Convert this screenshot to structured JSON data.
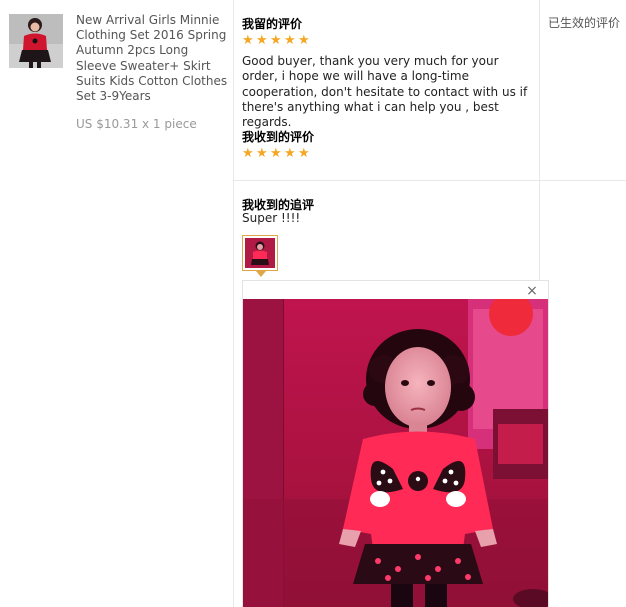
{
  "product": {
    "title": "New Arrival Girls Minnie Clothing Set 2016 Spring Autumn 2pcs Long Sleeve Sweater+ Skirt Suits Kids Cotton Clothes Set 3-9Years",
    "price": "US $10.31 x 1 piece",
    "thumbnail": "photo of a girl in red Minnie sweater and dark skirt"
  },
  "my_feedback": {
    "title": "我留的评价",
    "rating": 5,
    "text": "Good buyer, thank you very much for your order, i hope we will have a long-time cooperation, don't hesitate to contact with us if there's anything what i can help you , best regards."
  },
  "received_feedback": {
    "title": "我收到的评价",
    "rating": 5
  },
  "followup": {
    "title": "我收到的追评",
    "text": "Super !!!!",
    "close_icon": "×"
  },
  "status": {
    "label": "已生效的评价"
  },
  "colors": {
    "star": "#f5a623",
    "thumb_border": "#e0a64a",
    "divider": "#e8e8e8"
  }
}
